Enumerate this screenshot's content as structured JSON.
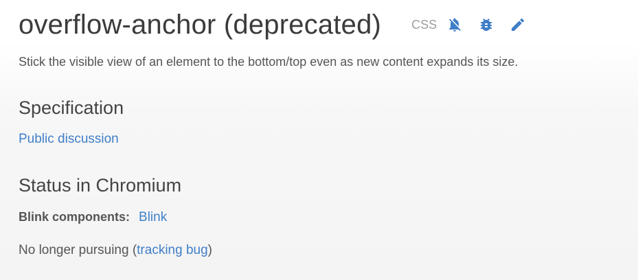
{
  "feature": {
    "title": "overflow-anchor (deprecated)",
    "category": "CSS",
    "summary": "Stick the visible view of an element to the bottom/top even as new content expands its size."
  },
  "icons": {
    "notifications": "notifications-off-icon",
    "bug": "bug-icon",
    "edit": "edit-pencil-icon",
    "accent_color": "#3f7ec8"
  },
  "specification": {
    "heading": "Specification",
    "link_label": "Public discussion"
  },
  "status": {
    "heading": "Status in Chromium",
    "blink_label": "Blink components:",
    "blink_value": "Blink",
    "state_prefix": "No longer pursuing (",
    "state_link": "tracking bug",
    "state_suffix": ")"
  }
}
